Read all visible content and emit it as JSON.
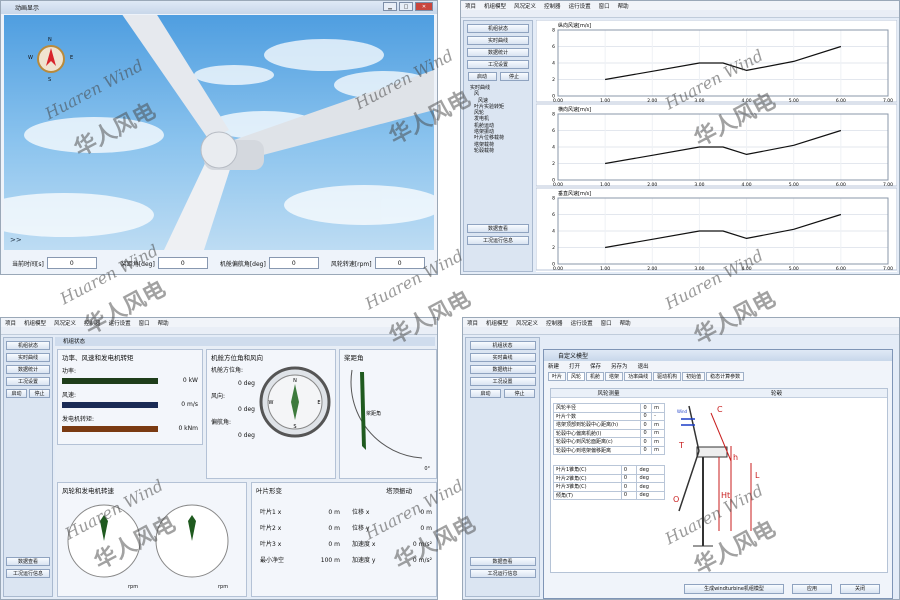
{
  "q1": {
    "title": "动画显示",
    "compass": {
      "n": "N",
      "e": "E",
      "s": "S",
      "w": "W"
    },
    "expand": ">>",
    "fields": [
      {
        "label": "当前时间[s]",
        "value": "0"
      },
      {
        "label": "桨距角[deg]",
        "value": "0"
      },
      {
        "label": "机舱偏航角[deg]",
        "value": "0"
      },
      {
        "label": "风轮转速[rpm]",
        "value": "0"
      }
    ]
  },
  "menu": [
    "项目",
    "机组模型",
    "风况定义",
    "控制器",
    "运行设置",
    "窗口",
    "帮助"
  ],
  "left_buttons": [
    "机组状态",
    "实时曲线",
    "数据统计",
    "工况设置"
  ],
  "start": "启动",
  "stop": "停止",
  "bottom_buttons": [
    "数据查看",
    "工况运行信息"
  ],
  "tree": [
    "实时曲线",
    "风",
    "风速",
    "叶片实验转矩",
    "风轮",
    "发电机",
    "机舱运动",
    "塔架振动",
    "叶片位移载荷",
    "塔架载荷",
    "轮毂载荷"
  ],
  "chart_data": [
    {
      "type": "line",
      "title": "纵向风速[m/s]",
      "xlim": [
        0,
        7
      ],
      "ylim": [
        0,
        8
      ],
      "xticks": [
        "0.00",
        "1.00",
        "2.00",
        "3.00",
        "4.00",
        "5.00",
        "6.00",
        "7.00"
      ],
      "yticks": [
        "0",
        "2",
        "4",
        "6",
        "8"
      ],
      "x": [
        1,
        2,
        3,
        3.5,
        4,
        5,
        6
      ],
      "y": [
        2,
        3,
        4,
        4,
        3.1,
        4.2,
        6
      ]
    },
    {
      "type": "line",
      "title": "横向风速[m/s]",
      "xlim": [
        0,
        7
      ],
      "ylim": [
        0,
        8
      ],
      "xticks": [
        "0.00",
        "1.00",
        "2.00",
        "3.00",
        "4.00",
        "5.00",
        "6.00",
        "7.00"
      ],
      "yticks": [
        "0",
        "2",
        "4",
        "6",
        "8"
      ],
      "x": [
        1,
        2,
        3,
        3.5,
        4,
        5,
        6
      ],
      "y": [
        2,
        3,
        4,
        4,
        3.1,
        4.2,
        6
      ]
    },
    {
      "type": "line",
      "title": "垂直风速[m/s]",
      "xlim": [
        0,
        7
      ],
      "ylim": [
        0,
        8
      ],
      "xticks": [
        "0.00",
        "1.00",
        "2.00",
        "3.00",
        "4.00",
        "5.00",
        "6.00",
        "7.00"
      ],
      "yticks": [
        "0",
        "2",
        "4",
        "6",
        "8"
      ],
      "x": [
        1,
        2,
        3,
        3.5,
        4,
        5,
        6
      ],
      "y": [
        2,
        3,
        4,
        4,
        3.1,
        4.2,
        6
      ]
    }
  ],
  "q3": {
    "title": "机组状态",
    "power_title": "功率、风速和发电机转矩",
    "power": {
      "label": "功率:",
      "value": "0 kW"
    },
    "wind": {
      "label": "风速:",
      "value": "0 m/s"
    },
    "torque": {
      "label": "发电机转矩:",
      "value": "0 kNm"
    },
    "nacelle_title": "机舱方位角和风向",
    "nac_az": {
      "label": "机舱方位角:",
      "value": "0 deg"
    },
    "wind_dir": {
      "label": "风向:",
      "value": "0 deg"
    },
    "yaw_err": {
      "label": "偏航角:",
      "value": "0 deg"
    },
    "pitch_title": "桨距角",
    "pitch_label": "桨距角",
    "pitch_unit": "0°",
    "speed_title": "风轮和发电机转速",
    "rpm_unit": "rpm",
    "blade_title": "叶片形变",
    "blades": [
      {
        "label": "叶片1 x",
        "value": "0 m"
      },
      {
        "label": "叶片2 x",
        "value": "0 m"
      },
      {
        "label": "叶片3 x",
        "value": "0 m"
      },
      {
        "label": "最小净空",
        "value": "100 m"
      }
    ],
    "tower_title": "塔顶振动",
    "tower": [
      {
        "label": "位移 x",
        "value": "0 m"
      },
      {
        "label": "位移 y",
        "value": "0 m"
      },
      {
        "label": "加速度 x",
        "value": "0 m/s²"
      },
      {
        "label": "加速度 y",
        "value": "0 m/s²"
      }
    ]
  },
  "q4": {
    "title": "自定义模型",
    "menu": [
      "新建",
      "打开",
      "保存",
      "另存为",
      "退出"
    ],
    "tabs": [
      "叶片",
      "风轮",
      "机舱",
      "塔架",
      "功率曲线",
      "驱动机构",
      "初始值",
      "稳态计算参数"
    ],
    "col1": "风轮测量",
    "col2": "轮毂",
    "rows": [
      {
        "label": "风轮半径",
        "value": "0",
        "unit": "m"
      },
      {
        "label": "叶片个数",
        "value": "0",
        "unit": "-"
      },
      {
        "label": "塔架顶部到轮毂中心距离(h)",
        "value": "0",
        "unit": "m"
      },
      {
        "label": "轮毂中心偏离机舱(l)",
        "value": "0",
        "unit": "m"
      },
      {
        "label": "轮毂中心到风轮面距离(c)",
        "value": "0",
        "unit": "m"
      },
      {
        "label": "轮毂中心到塔架偏移距离",
        "value": "0",
        "unit": "m"
      }
    ],
    "angles": [
      {
        "label": "叶片1锥角(C)",
        "value": "0",
        "unit": "deg"
      },
      {
        "label": "叶片2锥角(C)",
        "value": "0",
        "unit": "deg"
      },
      {
        "label": "叶片3锥角(C)",
        "value": "0",
        "unit": "deg"
      },
      {
        "label": "倾角(T)",
        "value": "0",
        "unit": "deg"
      }
    ],
    "diagram_labels": {
      "c": "C",
      "t": "T",
      "h": "h",
      "l": "L",
      "ht": "Ht",
      "o": "O",
      "wind": "Wind"
    },
    "gen_button": "生成windturbine机组模型",
    "apply": "应用",
    "close": "关闭"
  },
  "watermark": {
    "en": "Huaren Wind",
    "cn": "华人风电"
  }
}
